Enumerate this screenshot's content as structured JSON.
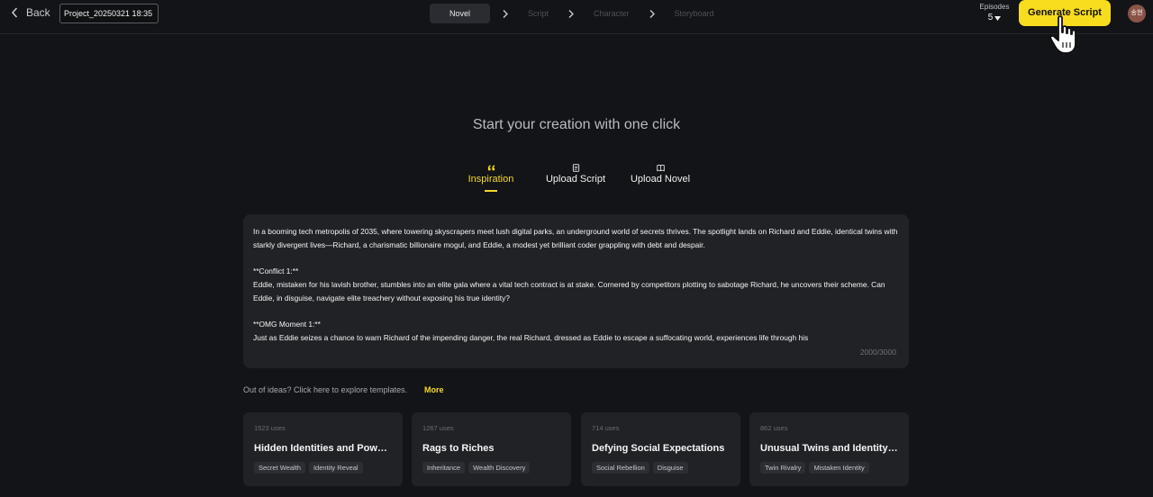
{
  "header": {
    "back_label": "Back",
    "project_name": "Project_20250321 18:35",
    "steps": [
      "Novel",
      "Script",
      "Character",
      "Storyboard"
    ],
    "active_step": "Novel",
    "episodes_label": "Episodes",
    "episodes_value": "5",
    "generate_label": "Generate Script",
    "avatar_text": "송현"
  },
  "main": {
    "headline": "Start your creation with one click",
    "tabs": [
      {
        "label": "Inspiration",
        "icon": "quote-icon",
        "active": true
      },
      {
        "label": "Upload Script",
        "icon": "document-icon",
        "active": false
      },
      {
        "label": "Upload Novel",
        "icon": "book-icon",
        "active": false
      }
    ],
    "editor_text": "In a booming tech metropolis of 2035, where towering skyscrapers meet lush digital parks, an underground world of secrets thrives. The spotlight lands on Richard and Eddie, identical twins with starkly divergent lives—Richard, a charismatic billionaire mogul, and Eddie, a modest yet brilliant coder grappling with debt and despair.\n\n**Conflict 1:**\nEddie, mistaken for his lavish brother, stumbles into an elite gala where a vital tech contract is at stake. Cornered by competitors plotting to sabotage Richard, he uncovers their scheme. Can Eddie, in disguise, navigate elite treachery without exposing his true identity?\n\n**OMG Moment 1:**\nJust as Eddie seizes a chance to warn Richard of the impending danger, the real Richard, dressed as Eddie to escape a suffocating world, experiences life through his",
    "char_count": "2000/3000",
    "ideas_text": "Out of ideas? Click here to explore templates.",
    "more_label": "More",
    "templates": [
      {
        "uses": "1523 uses",
        "title": "Hidden Identities and Power Plays",
        "tags": [
          "Secret Wealth",
          "Identity Reveal"
        ]
      },
      {
        "uses": "1267 uses",
        "title": "Rags to Riches",
        "tags": [
          "Inheritance",
          "Wealth Discovery"
        ]
      },
      {
        "uses": "714 uses",
        "title": "Defying Social Expectations",
        "tags": [
          "Social Rebellion",
          "Disguise"
        ]
      },
      {
        "uses": "862 uses",
        "title": "Unusual Twins and Identity Swaps",
        "tags": [
          "Twin Rivalry",
          "Mistaken Identity"
        ]
      }
    ]
  },
  "colors": {
    "background": "#131417",
    "accent": "#f8dc1e",
    "panel": "#212226"
  }
}
